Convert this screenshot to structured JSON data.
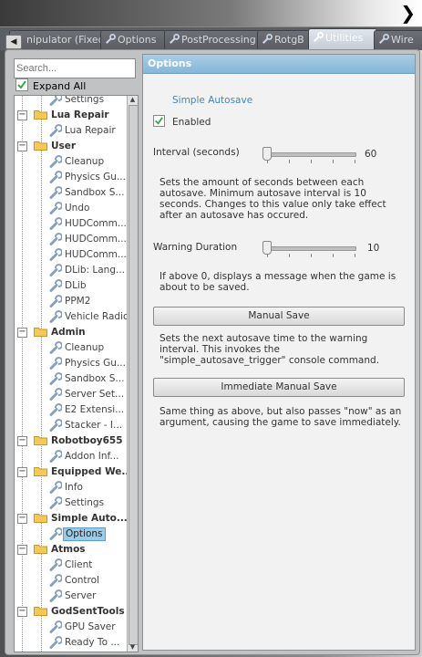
{
  "tabs": [
    {
      "label": "nipulator (Fixed)",
      "active": false
    },
    {
      "label": "Options",
      "active": false
    },
    {
      "label": "PostProcessing",
      "active": false
    },
    {
      "label": "RotgB",
      "active": false
    },
    {
      "label": "Utilities",
      "active": true
    },
    {
      "label": "Wire",
      "active": false
    }
  ],
  "tab_scroll_glyph": "◀",
  "top_arrow_glyph": "❯",
  "search": {
    "placeholder": "Search..."
  },
  "expand_all": {
    "label": "Expand All",
    "checked": true
  },
  "tree": [
    {
      "type": "item",
      "label": "Settings"
    },
    {
      "type": "folder",
      "label": "Lua Repair",
      "expander": "−"
    },
    {
      "type": "item",
      "label": "Lua Repair"
    },
    {
      "type": "folder",
      "label": "User",
      "expander": "−"
    },
    {
      "type": "item",
      "label": "Cleanup"
    },
    {
      "type": "item",
      "label": "Physics Gu..."
    },
    {
      "type": "item",
      "label": "Sandbox S..."
    },
    {
      "type": "item",
      "label": "Undo"
    },
    {
      "type": "item",
      "label": "HUDComm..."
    },
    {
      "type": "item",
      "label": "HUDComm..."
    },
    {
      "type": "item",
      "label": "HUDComm..."
    },
    {
      "type": "item",
      "label": "DLib: Lang..."
    },
    {
      "type": "item",
      "label": "DLib"
    },
    {
      "type": "item",
      "label": "PPM2"
    },
    {
      "type": "item",
      "label": "Vehicle Radio"
    },
    {
      "type": "folder",
      "label": "Admin",
      "expander": "−"
    },
    {
      "type": "item",
      "label": "Cleanup"
    },
    {
      "type": "item",
      "label": "Physics Gu..."
    },
    {
      "type": "item",
      "label": "Sandbox S..."
    },
    {
      "type": "item",
      "label": "Server Set..."
    },
    {
      "type": "item",
      "label": "E2 Extensi..."
    },
    {
      "type": "item",
      "label": "Stacker - I..."
    },
    {
      "type": "folder",
      "label": "Robotboy655",
      "expander": "−"
    },
    {
      "type": "item",
      "label": "Addon Inf..."
    },
    {
      "type": "folder",
      "label": "Equipped We...",
      "expander": "−"
    },
    {
      "type": "item",
      "label": "Info"
    },
    {
      "type": "item",
      "label": "Settings"
    },
    {
      "type": "folder",
      "label": "Simple Auto...",
      "expander": "−"
    },
    {
      "type": "item",
      "label": "Options",
      "selected": true
    },
    {
      "type": "folder",
      "label": "Atmos",
      "expander": "−"
    },
    {
      "type": "item",
      "label": "Client"
    },
    {
      "type": "item",
      "label": "Control"
    },
    {
      "type": "item",
      "label": "Server"
    },
    {
      "type": "folder",
      "label": "GodSentTools",
      "expander": "−"
    },
    {
      "type": "item",
      "label": "GPU Saver"
    },
    {
      "type": "item",
      "label": "Ready To ..."
    }
  ],
  "scroll_up_glyph": "▲",
  "scroll_down_glyph": "▼",
  "options": {
    "header": "Options",
    "section_title": "Simple Autosave",
    "enabled": {
      "label": "Enabled",
      "checked": true
    },
    "interval": {
      "label": "Interval (seconds)",
      "value": "60"
    },
    "interval_desc": "Sets the amount of seconds between each autosave. Minimum autosave interval is 10 seconds. Changes to this value only take effect after an autosave has occured.",
    "warning": {
      "label": "Warning Duration",
      "value": "10"
    },
    "warning_desc": "If above 0, displays a message when the game is about to be saved.",
    "manual_save_label": "Manual Save",
    "manual_save_desc": "Sets the next autosave time to the warning interval. This invokes the \"simple_autosave_trigger\" console command.",
    "immediate_save_label": "Immediate Manual Save",
    "immediate_save_desc": "Same thing as above, but also passes \"now\" as an argument, causing the game to save immediately."
  },
  "colors": {
    "accent": "#3a89c0",
    "header": "#94c0de",
    "selection": "#99cce8"
  }
}
